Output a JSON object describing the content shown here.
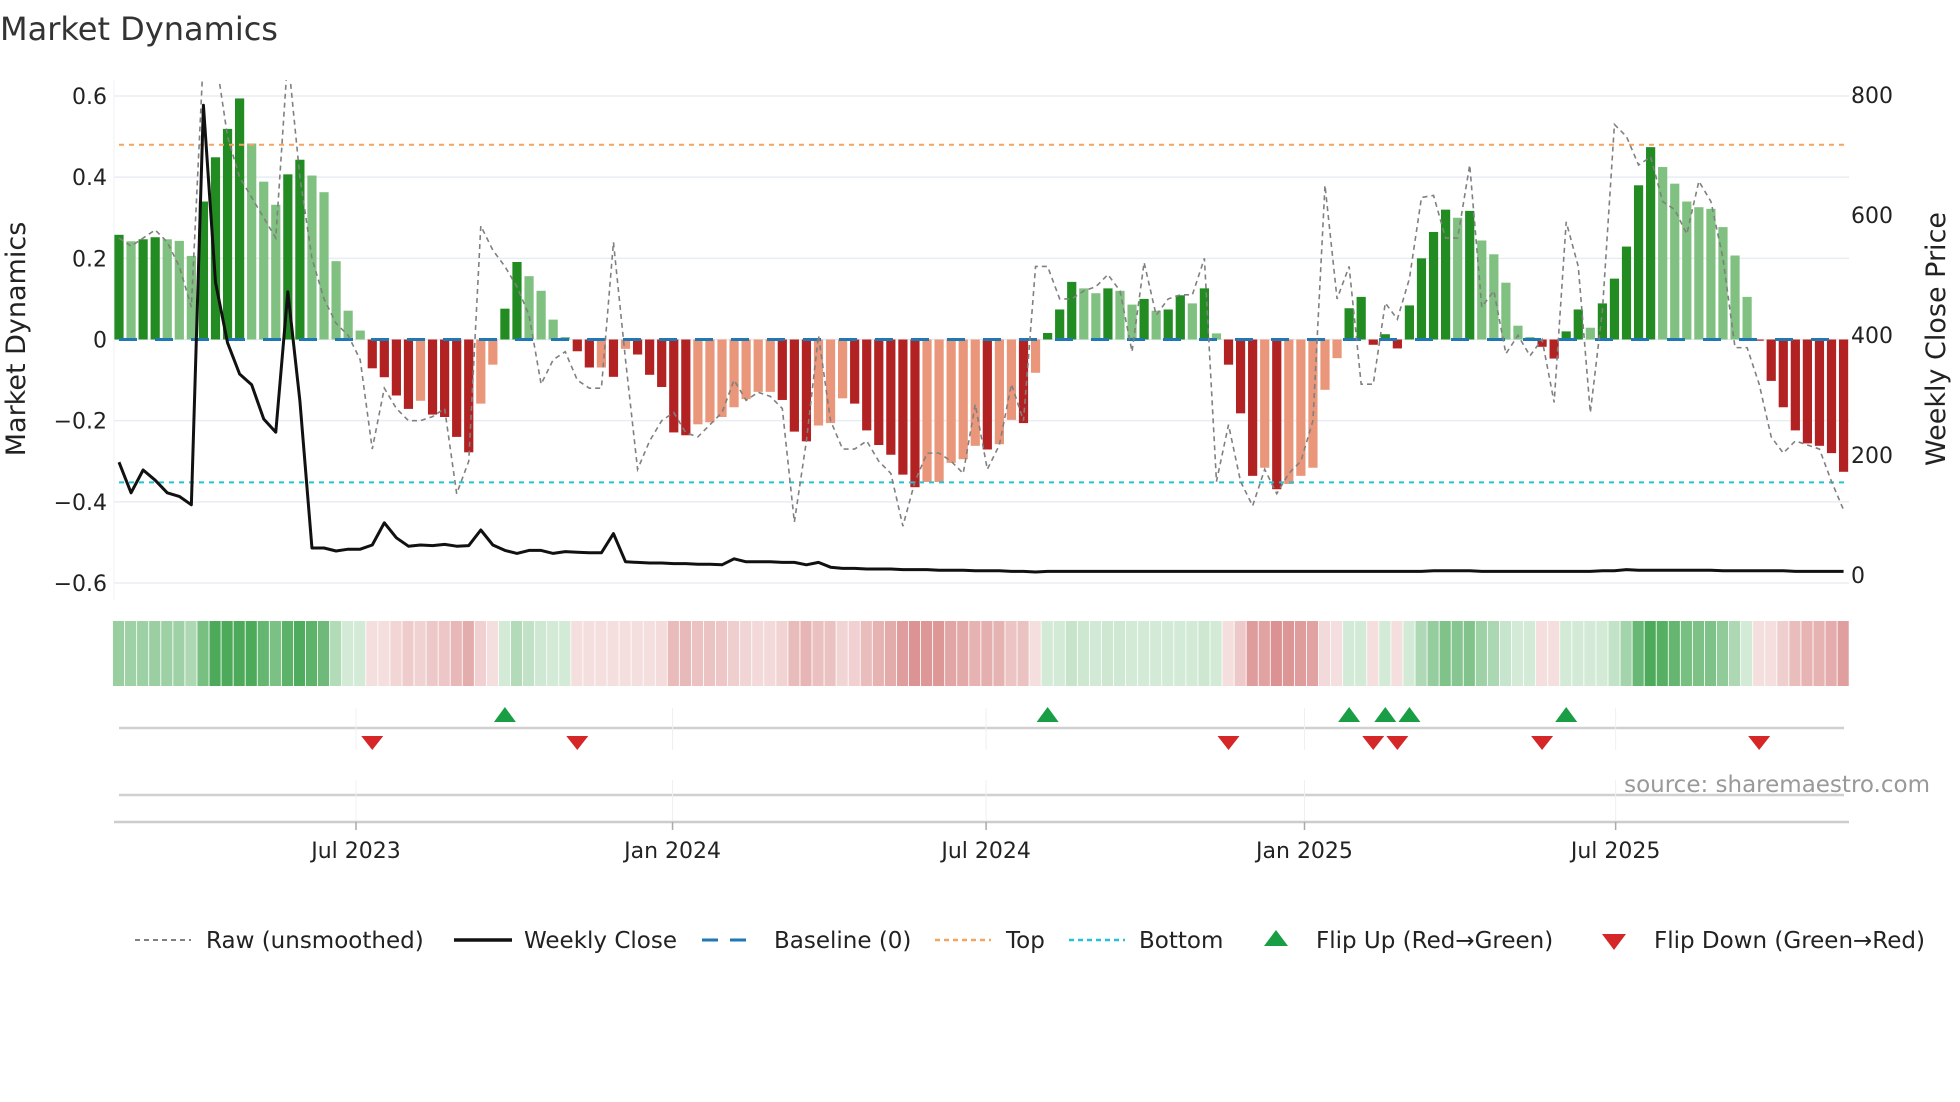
{
  "title": "Market Dynamics",
  "source": "source: sharemaestro.com",
  "legend": {
    "raw": "Raw (unsmoothed)",
    "close": "Weekly Close",
    "baseline": "Baseline (0)",
    "top": "Top",
    "bottom": "Bottom",
    "flip_up": "Flip Up (Red→Green)",
    "flip_down": "Flip Down (Green→Red)"
  },
  "colors": {
    "pos_rising": "#228b22",
    "pos_falling": "#80c080",
    "neg_falling": "#b22222",
    "neg_rising": "#e9967a",
    "raw": "#808080",
    "close": "#111111",
    "baseline": "#1f77b4",
    "top": "#f4a460",
    "bottom": "#22c3d3",
    "flip_up": "#1a9e45",
    "flip_down": "#d62728",
    "heat_green": "#4caa5a",
    "heat_red": "#d47a7a"
  },
  "chart_data": {
    "type": "bar",
    "title": "Market Dynamics",
    "ylabel": "Market Dynamics",
    "y2label": "Weekly Close Price",
    "ylim": [
      -0.6,
      0.6
    ],
    "y2lim": [
      0,
      800
    ],
    "yticks": [
      "0.6",
      "0.4",
      "0.2",
      "0",
      "−0.2",
      "−0.4",
      "−0.6"
    ],
    "ytick_values": [
      0.6,
      0.4,
      0.2,
      0,
      -0.2,
      -0.4,
      -0.6
    ],
    "y2ticks": [
      "800",
      "600",
      "400",
      "200",
      "0"
    ],
    "y2tick_values": [
      800,
      600,
      400,
      200,
      0
    ],
    "x_unit": "week index",
    "xticks": [
      {
        "label": "Jul 2023",
        "week": 19.65
      },
      {
        "label": "Jan 2024",
        "week": 45.9
      },
      {
        "label": "Jul 2024",
        "week": 71.9
      },
      {
        "label": "Jan 2025",
        "week": 98.3
      },
      {
        "label": "Jul 2025",
        "week": 124.1
      }
    ],
    "top_level": 0.48,
    "bottom_level": -0.352,
    "baseline": 0,
    "smoothed": [
      0.258,
      0.242,
      0.247,
      0.252,
      0.247,
      0.243,
      0.206,
      0.34,
      0.449,
      0.519,
      0.594,
      0.483,
      0.389,
      0.332,
      0.407,
      0.443,
      0.404,
      0.363,
      0.193,
      0.071,
      0.022,
      -0.071,
      -0.093,
      -0.138,
      -0.171,
      -0.151,
      -0.185,
      -0.191,
      -0.24,
      -0.278,
      -0.158,
      -0.062,
      0.076,
      0.191,
      0.156,
      0.12,
      0.049,
      0.006,
      -0.029,
      -0.069,
      -0.069,
      -0.092,
      -0.023,
      -0.037,
      -0.087,
      -0.117,
      -0.229,
      -0.236,
      -0.209,
      -0.204,
      -0.191,
      -0.167,
      -0.147,
      -0.129,
      -0.129,
      -0.149,
      -0.227,
      -0.251,
      -0.212,
      -0.206,
      -0.145,
      -0.158,
      -0.224,
      -0.26,
      -0.284,
      -0.333,
      -0.364,
      -0.351,
      -0.351,
      -0.304,
      -0.295,
      -0.262,
      -0.271,
      -0.258,
      -0.198,
      -0.206,
      -0.082,
      0.016,
      0.074,
      0.142,
      0.126,
      0.114,
      0.126,
      0.12,
      0.086,
      0.1,
      0.071,
      0.074,
      0.109,
      0.089,
      0.126,
      0.015,
      -0.062,
      -0.182,
      -0.336,
      -0.316,
      -0.369,
      -0.356,
      -0.336,
      -0.316,
      -0.124,
      -0.046,
      0.077,
      0.105,
      -0.013,
      0.013,
      -0.022,
      0.084,
      0.2,
      0.265,
      0.32,
      0.3,
      0.317,
      0.244,
      0.21,
      0.14,
      0.034,
      0.006,
      -0.018,
      -0.047,
      0.02,
      0.074,
      0.029,
      0.089,
      0.15,
      0.229,
      0.38,
      0.474,
      0.425,
      0.384,
      0.34,
      0.326,
      0.322,
      0.277,
      0.207,
      0.105,
      -0.003,
      -0.102,
      -0.167,
      -0.224,
      -0.256,
      -0.262,
      -0.28,
      -0.326
    ],
    "raw": [
      0.25,
      0.23,
      0.25,
      0.27,
      0.24,
      0.18,
      0.08,
      0.7,
      0.7,
      0.5,
      0.4,
      0.35,
      0.3,
      0.25,
      0.7,
      0.4,
      0.2,
      0.1,
      0.04,
      0.01,
      -0.05,
      -0.27,
      -0.12,
      -0.17,
      -0.2,
      -0.2,
      -0.19,
      -0.17,
      -0.38,
      -0.3,
      0.28,
      0.22,
      0.18,
      0.13,
      0.06,
      -0.11,
      -0.05,
      -0.03,
      -0.1,
      -0.12,
      -0.12,
      0.24,
      -0.05,
      -0.32,
      -0.25,
      -0.2,
      -0.18,
      -0.23,
      -0.24,
      -0.21,
      -0.18,
      -0.1,
      -0.15,
      -0.13,
      -0.14,
      -0.17,
      -0.45,
      -0.25,
      0.01,
      -0.2,
      -0.27,
      -0.27,
      -0.25,
      -0.3,
      -0.33,
      -0.46,
      -0.35,
      -0.28,
      -0.28,
      -0.3,
      -0.33,
      -0.16,
      -0.32,
      -0.26,
      -0.11,
      -0.2,
      0.18,
      0.18,
      0.1,
      0.1,
      0.12,
      0.13,
      0.16,
      0.12,
      -0.03,
      0.19,
      0.06,
      0.1,
      0.11,
      0.11,
      0.2,
      -0.35,
      -0.21,
      -0.35,
      -0.41,
      -0.32,
      -0.38,
      -0.33,
      -0.3,
      -0.2,
      0.38,
      0.1,
      0.18,
      -0.11,
      -0.11,
      0.09,
      0.05,
      0.15,
      0.35,
      0.355,
      0.25,
      0.25,
      0.43,
      0.08,
      0.12,
      -0.035,
      0.01,
      -0.04,
      0,
      -0.155,
      0.29,
      0.18,
      -0.18,
      0.07,
      0.53,
      0.5,
      0.43,
      0.45,
      0.34,
      0.32,
      0.26,
      0.39,
      0.34,
      0.2,
      -0.02,
      -0.02,
      -0.11,
      -0.24,
      -0.28,
      -0.25,
      -0.26,
      -0.27,
      -0.35,
      -0.42
    ],
    "weekly_close": [
      188,
      137,
      175,
      158,
      137,
      131,
      117,
      783,
      488,
      387,
      335,
      317,
      260,
      238,
      472,
      290,
      45,
      45,
      40,
      43,
      43,
      50,
      87,
      62,
      48,
      50,
      49,
      51,
      48,
      49,
      75,
      50,
      41,
      36,
      41,
      41,
      36,
      39,
      38,
      37,
      37,
      69,
      22,
      21,
      20,
      20,
      19,
      19,
      18,
      18,
      17,
      27,
      22,
      22,
      22,
      21,
      21,
      17,
      21,
      13,
      11,
      11,
      10,
      10,
      10,
      9,
      9,
      9,
      8,
      8,
      8,
      7,
      7,
      7,
      6,
      6,
      5,
      6,
      6,
      6,
      6,
      6,
      6,
      6,
      6,
      6,
      6,
      6,
      6,
      6,
      6,
      6,
      6,
      6,
      6,
      6,
      6,
      6,
      6,
      6,
      6,
      6,
      6,
      6,
      6,
      6,
      6,
      6,
      6,
      7,
      7,
      7,
      7,
      6,
      6,
      6,
      6,
      6,
      6,
      6,
      6,
      6,
      6,
      7,
      7,
      9,
      8,
      8,
      8,
      8,
      8,
      8,
      8,
      7,
      7,
      7,
      7,
      7,
      7,
      6,
      6,
      6,
      6,
      6
    ]
  }
}
